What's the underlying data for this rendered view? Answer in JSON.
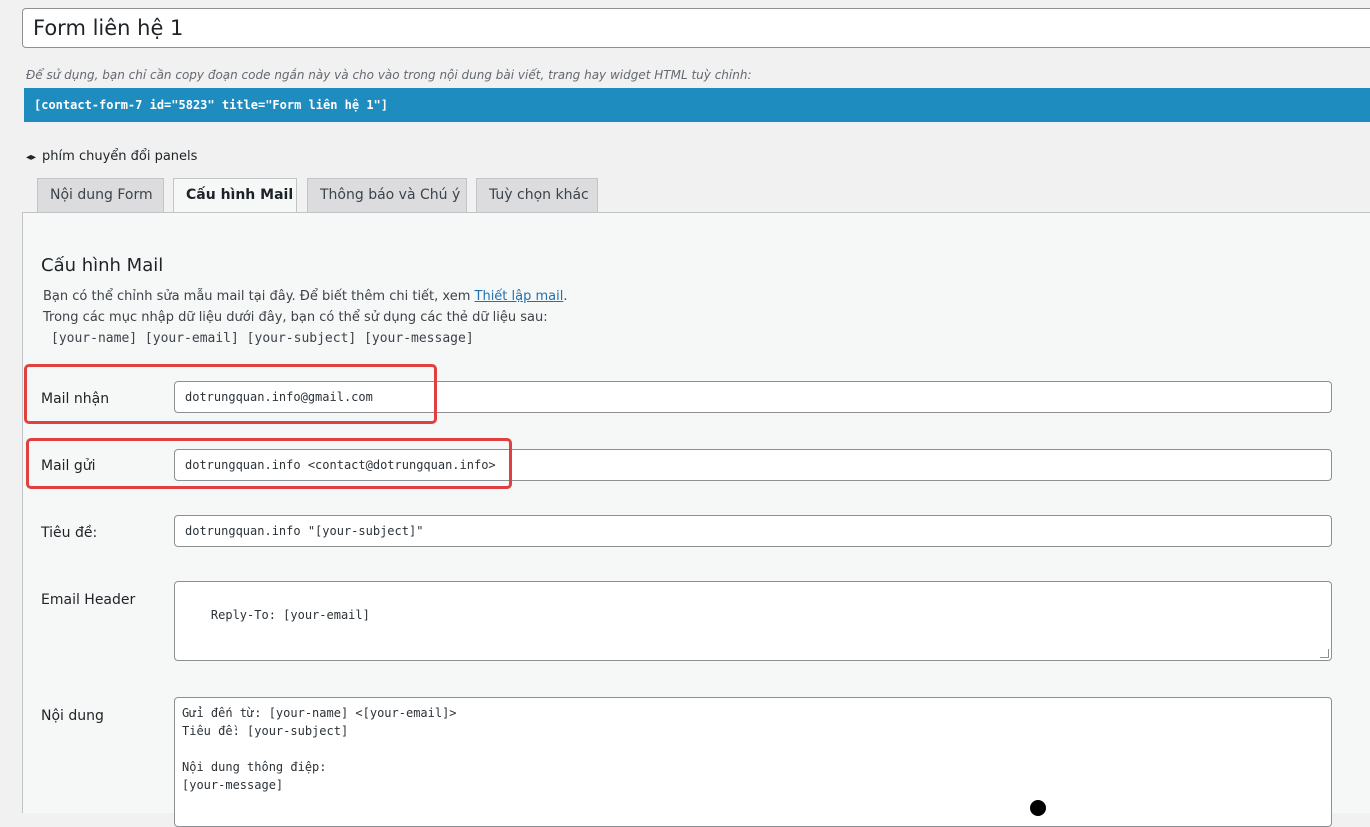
{
  "form_title": "Form liên hệ 1",
  "shortcode_hint": "Để sử dụng, bạn chỉ cần copy đoạn code ngắn này và cho vào trong nội dung bài viết, trang hay widget HTML tuỳ chỉnh:",
  "shortcode": "[contact-form-7 id=\"5823\" title=\"Form liên hệ 1\"]",
  "panels_toggle": {
    "icon": "◂▸",
    "label": "phím chuyển đổi panels"
  },
  "tabs": [
    {
      "label": "Nội dung Form"
    },
    {
      "label": "Cấu hình Mail"
    },
    {
      "label": "Thông báo và Chú ý"
    },
    {
      "label": "Tuỳ chọn khác"
    }
  ],
  "mail_panel": {
    "title": "Cấu hình Mail",
    "desc_before_link": "Bạn có thể chỉnh sửa mẫu mail tại đây. Để biết thêm chi tiết, xem ",
    "desc_link": "Thiết lập mail",
    "desc_after_link": ".",
    "desc_line2": "Trong các mục nhập dữ liệu dưới đây, bạn có thể sử dụng các thẻ dữ liệu sau:",
    "tags": "[your-name] [your-email] [your-subject] [your-message]",
    "fields": {
      "to": {
        "label": "Mail nhận",
        "value": "dotrungquan.info@gmail.com"
      },
      "from": {
        "label": "Mail gửi",
        "value": "dotrungquan.info <contact@dotrungquan.info>"
      },
      "subject": {
        "label": "Tiêu đề:",
        "value": "dotrungquan.info \"[your-subject]\""
      },
      "headers": {
        "label": "Email Header",
        "value": "Reply-To: [your-email]"
      },
      "body": {
        "label": "Nội dung",
        "value": "Gửi đến từ: [your-name] <[your-email]>\nTiêu đề: [your-subject]\n\nNội dung thông điệp:\n[your-message]"
      }
    }
  },
  "colors": {
    "shortcode_bg": "#1e8cbe",
    "highlight": "#e04040",
    "link": "#2271b1"
  }
}
